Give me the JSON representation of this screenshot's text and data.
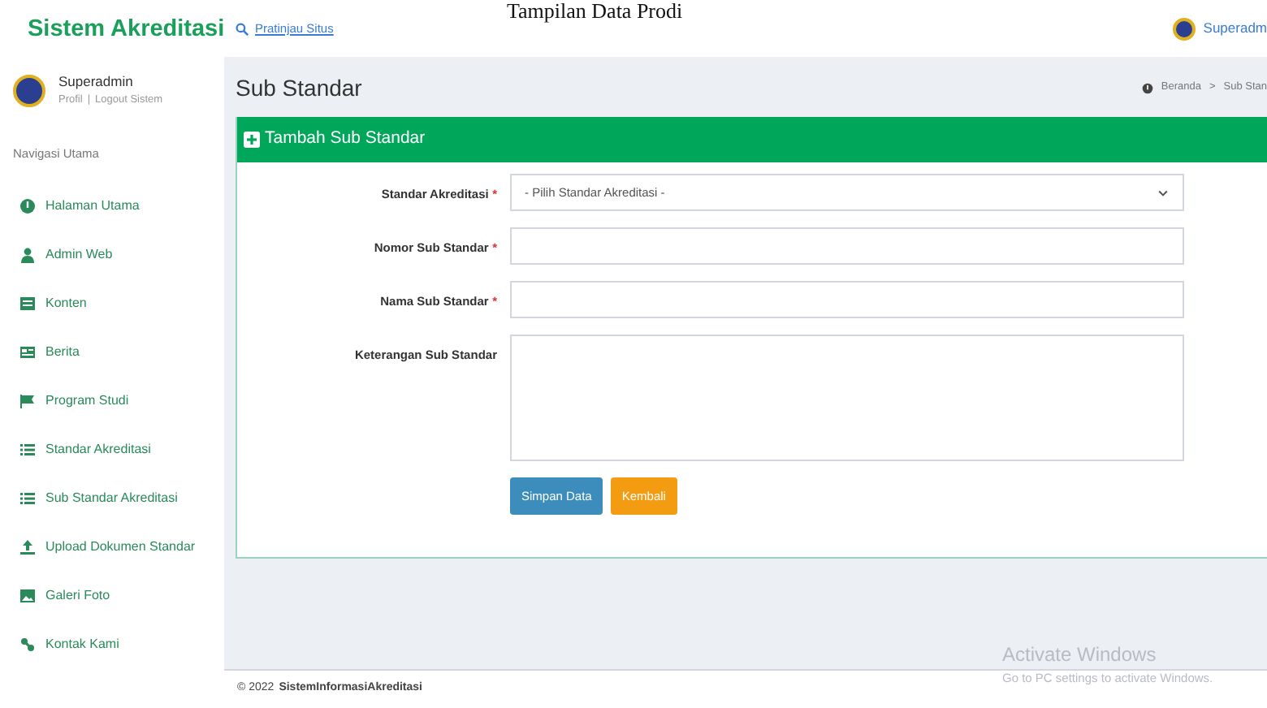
{
  "caption": "Tampilan Data Prodi",
  "brand": "Sistem Akreditasi",
  "topbar": {
    "preview_link": "Pratinjau Situs",
    "user": "Superadm"
  },
  "sidebar": {
    "user": {
      "name": "Superadmin",
      "links": [
        "Profil",
        "Logout Sistem"
      ],
      "separator": "|"
    },
    "section": "Navigasi Utama",
    "items": [
      {
        "label": "Halaman Utama"
      },
      {
        "label": "Admin Web"
      },
      {
        "label": "Konten"
      },
      {
        "label": "Berita"
      },
      {
        "label": "Program Studi"
      },
      {
        "label": "Standar Akreditasi"
      },
      {
        "label": "Sub Standar Akreditasi"
      },
      {
        "label": "Upload Dokumen Standar"
      },
      {
        "label": "Galeri Foto"
      },
      {
        "label": "Kontak Kami"
      }
    ]
  },
  "page": {
    "title": "Sub Standar",
    "breadcrumb": [
      "Beranda",
      "Sub Stan"
    ],
    "breadcrumb_separator": ">"
  },
  "form": {
    "title": "Tambah Sub Standar",
    "required_mark": "*",
    "fields": [
      {
        "label": "Standar Akreditasi",
        "required": true,
        "kind": "select",
        "value": "- Pilih Standar Akreditasi -"
      },
      {
        "label": "Nomor Sub Standar",
        "required": true,
        "kind": "input"
      },
      {
        "label": "Nama Sub Standar",
        "required": true,
        "kind": "input"
      },
      {
        "label": "Keterangan Sub Standar",
        "required": false,
        "kind": "textarea"
      }
    ],
    "buttons": [
      {
        "label": "Simpan Data",
        "kind": "primary"
      },
      {
        "label": "Kembali",
        "kind": "warning"
      }
    ]
  },
  "footer": {
    "year": "© 2022",
    "name": "SistemInformasiAkreditasi"
  },
  "os_notice": {
    "title": "Activate Windows",
    "text": "Go to PC settings to activate Windows."
  }
}
